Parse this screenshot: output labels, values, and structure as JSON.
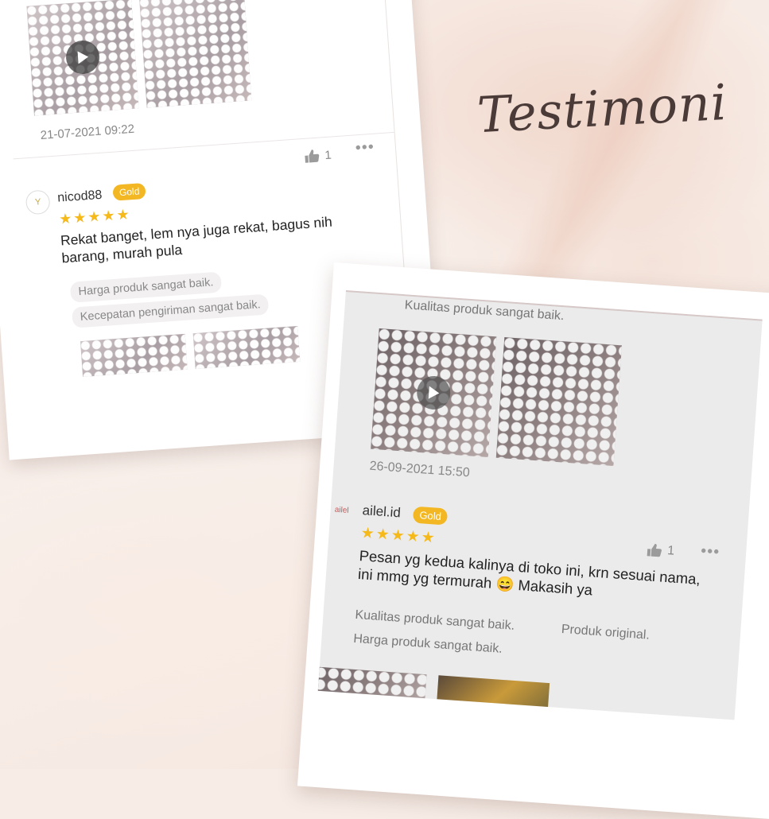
{
  "title": "Testimoni",
  "card1": {
    "date": "21-07-2021 09:22",
    "like_count": "1",
    "more": "•••",
    "username": "nicod88",
    "badge": "Gold",
    "rating": "★★★★★",
    "review": "Rekat banget, lem nya juga rekat, bagus nih barang, murah pula",
    "tags": [
      "Harga produk sangat baik.",
      "Kecepatan pengiriman sangat baik."
    ]
  },
  "card2": {
    "top_tag": "Kualitas produk sangat baik.",
    "date": "26-09-2021 15:50",
    "username": "ailel.id",
    "avatar_text": "ailel",
    "badge": "Gold",
    "rating": "★★★★★",
    "like_count": "1",
    "more": "•••",
    "review": "Pesan yg kedua kalinya di toko ini, krn sesuai nama, ini mmg yg termurah 😄 Makasih ya",
    "tags": [
      "Kualitas produk sangat baik.",
      "Produk original.",
      "Harga produk sangat baik."
    ]
  },
  "colors": {
    "badge": "#f2b722",
    "stars": "#f5b91a",
    "background": "#f7ece6"
  },
  "icons": [
    "play-icon",
    "thumbs-up-icon",
    "more-options-icon"
  ]
}
